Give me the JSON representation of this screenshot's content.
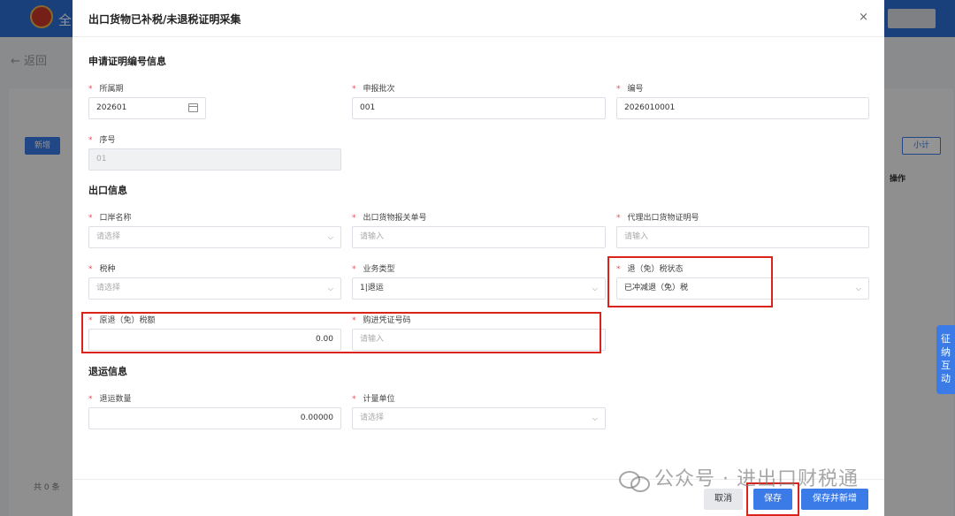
{
  "background": {
    "top_title": "全",
    "back_label": "返回",
    "new_label": "新增",
    "subtotal_label": "小计",
    "op_header": "操作",
    "total_text": "共 0 条",
    "side_tab": "征纳互动"
  },
  "modal": {
    "title": "出口货物已补税/未退税证明采集",
    "close_glyph": "×",
    "sections": {
      "cert": "申请证明编号信息",
      "export": "出口信息",
      "return": "退运信息"
    },
    "fields": {
      "period": {
        "label": "所属期",
        "value": "202601"
      },
      "batch": {
        "label": "申报批次",
        "value": "001"
      },
      "number": {
        "label": "编号",
        "value": "2026010001"
      },
      "seq": {
        "label": "序号",
        "value": "01"
      },
      "port": {
        "label": "口岸名称",
        "placeholder": "请选择"
      },
      "customs_no": {
        "label": "出口货物报关单号",
        "placeholder": "请输入"
      },
      "agent_cert": {
        "label": "代理出口货物证明号",
        "placeholder": "请输入"
      },
      "tax_type": {
        "label": "税种",
        "placeholder": "请选择"
      },
      "biz_type": {
        "label": "业务类型",
        "value": "1|退运"
      },
      "refund_status": {
        "label": "退（免）税状态",
        "value": "已冲减退（免）税"
      },
      "orig_amount": {
        "label": "原退（免）税额",
        "value": "0.00"
      },
      "voucher_no": {
        "label": "购进凭证号码",
        "placeholder": "请输入"
      },
      "return_qty": {
        "label": "退运数量",
        "value": "0.00000"
      },
      "unit": {
        "label": "计量单位",
        "placeholder": "请选择"
      }
    },
    "required_mark": "*",
    "buttons": {
      "cancel": "取消",
      "save": "保存",
      "save_new": "保存并新增"
    }
  },
  "watermark": "公众号 · 进出口财税通",
  "icons": {
    "calendar": "calendar-icon",
    "chevron": "chevron-down-icon",
    "close": "close-icon"
  },
  "colors": {
    "primary": "#3a7be8",
    "highlight": "#d9231b",
    "required": "#e34d59"
  }
}
